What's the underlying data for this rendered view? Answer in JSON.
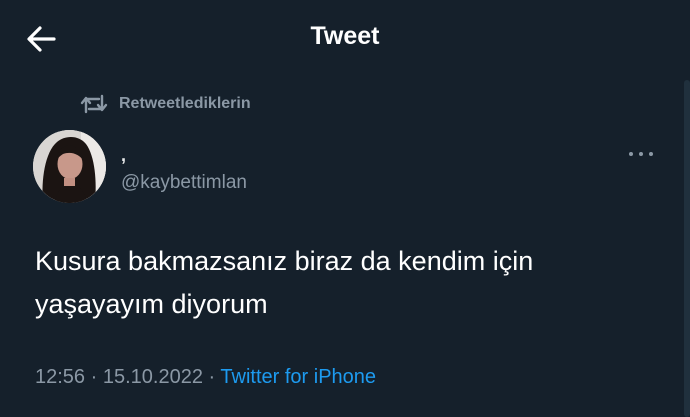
{
  "header": {
    "title": "Tweet"
  },
  "retweet": {
    "label": "Retweetlediklerin"
  },
  "tweet": {
    "display_name": ",",
    "handle": "@kaybettimlan",
    "text": "Kusura bakmazsanız biraz da kendim için yaşayayım diyorum",
    "time": "12:56",
    "separator": "·",
    "date": "15.10.2022",
    "source": "Twitter for iPhone"
  },
  "icons": {
    "back": "arrow-left-icon",
    "retweet": "retweet-icon",
    "more": "more-horizontal-icon",
    "avatar": "user-avatar"
  },
  "colors": {
    "background": "#15202b",
    "primary_text": "#ffffff",
    "secondary_text": "#8b98a5",
    "link": "#1d9bf0"
  }
}
